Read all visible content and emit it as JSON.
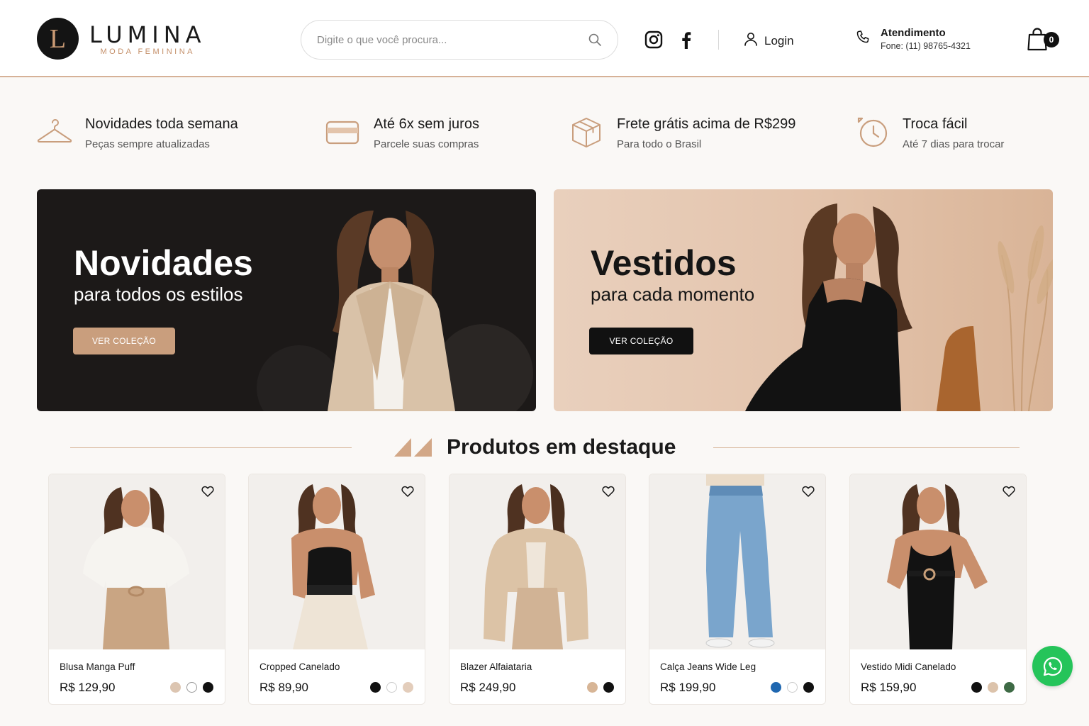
{
  "brand": {
    "initial": "L",
    "name": "LUMINA",
    "tagline": "MODA FEMININA"
  },
  "search": {
    "placeholder": "Digite o que você procura..."
  },
  "header": {
    "login_label": "Login",
    "support_title": "Atendimento",
    "support_phone": "Fone: (11) 98765-4321",
    "cart_count": "0"
  },
  "benefits": [
    {
      "icon": "hanger-icon",
      "title": "Novidades toda semana",
      "subtitle": "Peças sempre atualizadas"
    },
    {
      "icon": "credit-card-icon",
      "title": "Até 6x sem juros",
      "subtitle": "Parcele suas compras"
    },
    {
      "icon": "box-icon",
      "title": "Frete grátis acima de R$299",
      "subtitle": "Para todo o Brasil"
    },
    {
      "icon": "clock-icon",
      "title": "Troca fácil",
      "subtitle": "Até 7 dias para trocar"
    }
  ],
  "banners": [
    {
      "title": "Novidades",
      "subtitle": "para todos os estilos",
      "button": "VER COLEÇÃO"
    },
    {
      "title": "Vestidos",
      "subtitle": "para cada momento",
      "button": "VER COLEÇÃO"
    }
  ],
  "featured": {
    "title": "Produtos em destaque",
    "products": [
      {
        "name": "Blusa Manga Puff",
        "price": "R$ 129,90",
        "colors": [
          "#dcc5b1",
          "#ffffff",
          "#111111"
        ]
      },
      {
        "name": "Cropped Canelado",
        "price": "R$ 89,90",
        "colors": [
          "#111111",
          "#ffffff",
          "#e3cdbb"
        ]
      },
      {
        "name": "Blazer Alfaiataria",
        "price": "R$ 249,90",
        "colors": [
          "#d7b596",
          "#111111"
        ]
      },
      {
        "name": "Calça Jeans Wide Leg",
        "price": "R$ 199,90",
        "colors": [
          "#1f67b0",
          "#ffffff",
          "#111111"
        ]
      },
      {
        "name": "Vestido Midi Canelado",
        "price": "R$ 159,90",
        "colors": [
          "#111111",
          "#dcc3ab",
          "#3e6a45"
        ]
      }
    ]
  },
  "colors": {
    "accent": "#c99e7d",
    "dark": "#1c1918",
    "whatsapp": "#25c45a"
  }
}
